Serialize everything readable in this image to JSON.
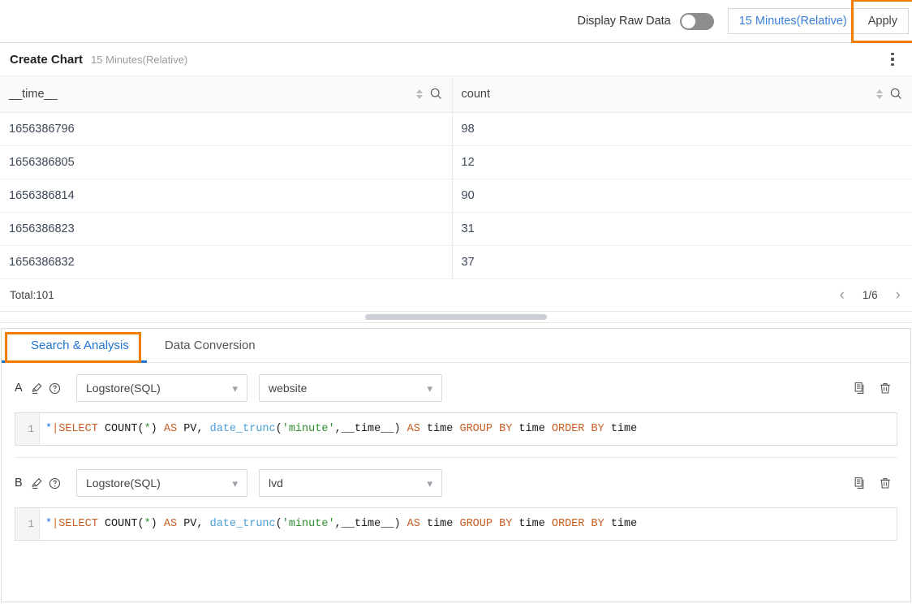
{
  "toolbar": {
    "raw_data_label": "Display Raw Data",
    "toggle_state": "off",
    "time_range": "15 Minutes(Relative)",
    "apply_label": "Apply",
    "highlight_color": "#f07c00"
  },
  "chart_panel": {
    "title": "Create Chart",
    "subtitle": "15 Minutes(Relative)",
    "menu_icon": "more-vertical-icon"
  },
  "table": {
    "columns": [
      {
        "name": "__time__",
        "sort_icon": "sort-icon",
        "search_icon": "search-icon"
      },
      {
        "name": "count",
        "sort_icon": "sort-icon",
        "search_icon": "search-icon"
      }
    ],
    "rows": [
      {
        "time": "1656386796",
        "count": "98"
      },
      {
        "time": "1656386805",
        "count": "12"
      },
      {
        "time": "1656386814",
        "count": "90"
      },
      {
        "time": "1656386823",
        "count": "31"
      },
      {
        "time": "1656386832",
        "count": "37"
      }
    ],
    "total_label": "Total:101",
    "page_indicator": "1/6",
    "prev_icon": "chevron-left-icon",
    "next_icon": "chevron-right-icon"
  },
  "tabs": {
    "items": [
      {
        "label": "Search & Analysis",
        "active": true
      },
      {
        "label": "Data Conversion",
        "active": false
      }
    ],
    "active_color": "#1f73d0",
    "highlight_color": "#f07c00"
  },
  "queries": [
    {
      "letter": "A",
      "edit_icon": "pencil-icon",
      "help_icon": "question-circle-icon",
      "source_select": "Logstore(SQL)",
      "logstore_select": "website",
      "copy_icon": "copy-icon",
      "delete_icon": "trash-icon",
      "line_number": "1",
      "sql": {
        "star": "*",
        "pipe": "|",
        "tokens": [
          {
            "t": "SELECT",
            "c": "kw"
          },
          {
            "t": " ",
            "c": "plain"
          },
          {
            "t": "COUNT",
            "c": "fn"
          },
          {
            "t": "(",
            "c": "plain"
          },
          {
            "t": "*",
            "c": "gstar"
          },
          {
            "t": ")",
            "c": "plain"
          },
          {
            "t": " ",
            "c": "plain"
          },
          {
            "t": "AS",
            "c": "kw"
          },
          {
            "t": " PV, ",
            "c": "plain"
          },
          {
            "t": "date_trunc",
            "c": "func"
          },
          {
            "t": "(",
            "c": "plain"
          },
          {
            "t": "'minute'",
            "c": "str"
          },
          {
            "t": ",__time__)",
            "c": "plain"
          },
          {
            "t": " ",
            "c": "plain"
          },
          {
            "t": "AS",
            "c": "kw"
          },
          {
            "t": " time ",
            "c": "plain"
          },
          {
            "t": "GROUP BY",
            "c": "kw"
          },
          {
            "t": " time ",
            "c": "plain"
          },
          {
            "t": "ORDER BY",
            "c": "kw"
          },
          {
            "t": " time",
            "c": "plain"
          }
        ]
      }
    },
    {
      "letter": "B",
      "edit_icon": "pencil-icon",
      "help_icon": "question-circle-icon",
      "source_select": "Logstore(SQL)",
      "logstore_select": "lvd",
      "copy_icon": "copy-icon",
      "delete_icon": "trash-icon",
      "line_number": "1",
      "sql": {
        "star": "*",
        "pipe": "|",
        "tokens": [
          {
            "t": "SELECT",
            "c": "kw"
          },
          {
            "t": " ",
            "c": "plain"
          },
          {
            "t": "COUNT",
            "c": "fn"
          },
          {
            "t": "(",
            "c": "plain"
          },
          {
            "t": "*",
            "c": "gstar"
          },
          {
            "t": ")",
            "c": "plain"
          },
          {
            "t": " ",
            "c": "plain"
          },
          {
            "t": "AS",
            "c": "kw"
          },
          {
            "t": " PV, ",
            "c": "plain"
          },
          {
            "t": "date_trunc",
            "c": "func"
          },
          {
            "t": "(",
            "c": "plain"
          },
          {
            "t": "'minute'",
            "c": "str"
          },
          {
            "t": ",__time__)",
            "c": "plain"
          },
          {
            "t": " ",
            "c": "plain"
          },
          {
            "t": "AS",
            "c": "kw"
          },
          {
            "t": " time ",
            "c": "plain"
          },
          {
            "t": "GROUP BY",
            "c": "kw"
          },
          {
            "t": " time ",
            "c": "plain"
          },
          {
            "t": "ORDER BY",
            "c": "kw"
          },
          {
            "t": " time",
            "c": "plain"
          }
        ]
      }
    }
  ]
}
